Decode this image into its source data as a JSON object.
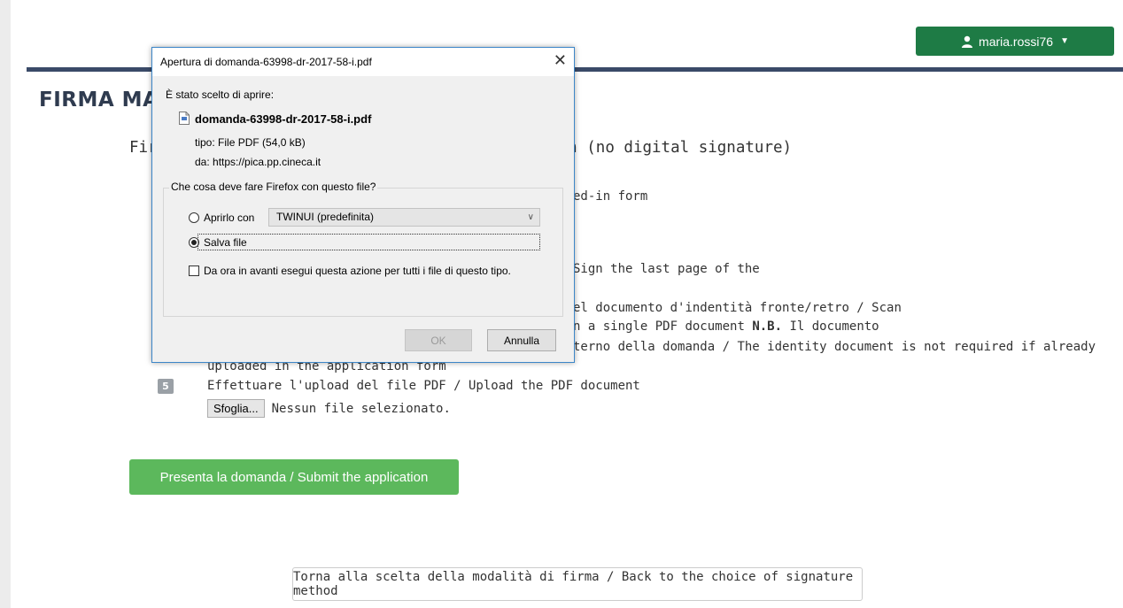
{
  "header": {
    "username": "maria.rossi76"
  },
  "page": {
    "title": "FIRMA MANUALE / MANUAL SIGNATURE",
    "subtitle": "Firma manuale della domanda / Manual application (no digital signature)"
  },
  "steps": {
    "step1_text": "Salvare la domanda compilata / Download your filled-in form",
    "step3_text_a": "Firmare l'ultima pagina della domanda stampata / Sign the last page of the",
    "step4_line1": "Effettuare la scansione della domanda firmata e del documento d'indentità fronte/retro / Scan",
    "step4_line2": "the signed application and ID (both sides), within a single PDF document",
    "step4_nb": "N.B.",
    "step4_line2b": " Il documento",
    "step4_line3": "d'identità non è richiesto se già caricato all'interno della domanda / The identity document is not required if already",
    "step4_line4": "uploaded in the application form",
    "step5_number": "5",
    "step5_text": "Effettuare l'upload del file PDF / Upload the PDF document",
    "browse_label": "Sfoglia...",
    "no_file_text": "Nessun file selezionato."
  },
  "actions": {
    "submit_label": "Presenta la domanda / Submit the application",
    "back_label": "Torna alla scelta della modalità di firma / Back to the choice of signature method"
  },
  "dialog": {
    "title": "Apertura di domanda-63998-dr-2017-58-i.pdf",
    "chosen_label": "È stato scelto di aprire:",
    "file_name": "domanda-63998-dr-2017-58-i.pdf",
    "type_label": "tipo:",
    "type_value": "File PDF (54,0 kB)",
    "from_label": "da:",
    "from_value": "https://pica.pp.cineca.it",
    "question": "Che cosa deve fare Firefox con questo file?",
    "open_with_label": "Aprirlo con",
    "open_with_app": "TWINUI (predefinita)",
    "save_label": "Salva file",
    "remember_label": "Da ora in avanti esegui questa azione per tutti i file di questo tipo.",
    "ok_label": "OK",
    "cancel_label": "Annulla",
    "open_with_checked": false,
    "save_checked": true,
    "remember_checked": false
  },
  "colors": {
    "user_button": "#1e7b45",
    "header_rule": "#3a4a68",
    "submit_button": "#5cb85c",
    "dialog_border": "#3c86c8"
  }
}
